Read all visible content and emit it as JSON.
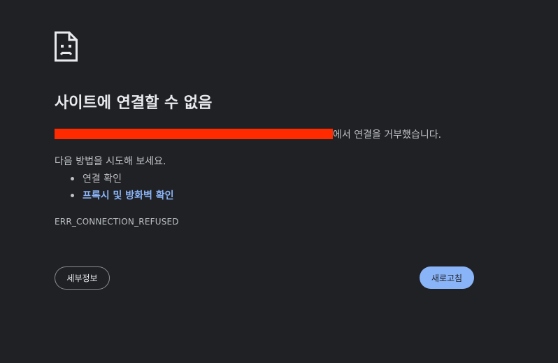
{
  "page": {
    "icon": "sad-page-icon",
    "title": "사이트에 연결할 수 없음",
    "message_suffix": "에서 연결을 거부했습니다.",
    "suggestions_heading": "다음 방법을 시도해 보세요.",
    "suggestions": [
      {
        "label": "연결 확인",
        "link": false
      },
      {
        "label": "프록시 및 방화벽 확인",
        "link": true
      }
    ],
    "error_code": "ERR_CONNECTION_REFUSED",
    "details_label": "세부정보",
    "reload_label": "새로고침"
  },
  "colors": {
    "background": "#202124",
    "text": "#bdc1c6",
    "title": "#e8eaed",
    "link": "#8ab4f8",
    "primary_button": "#8ab4f8",
    "redaction": "#ff2a00"
  }
}
